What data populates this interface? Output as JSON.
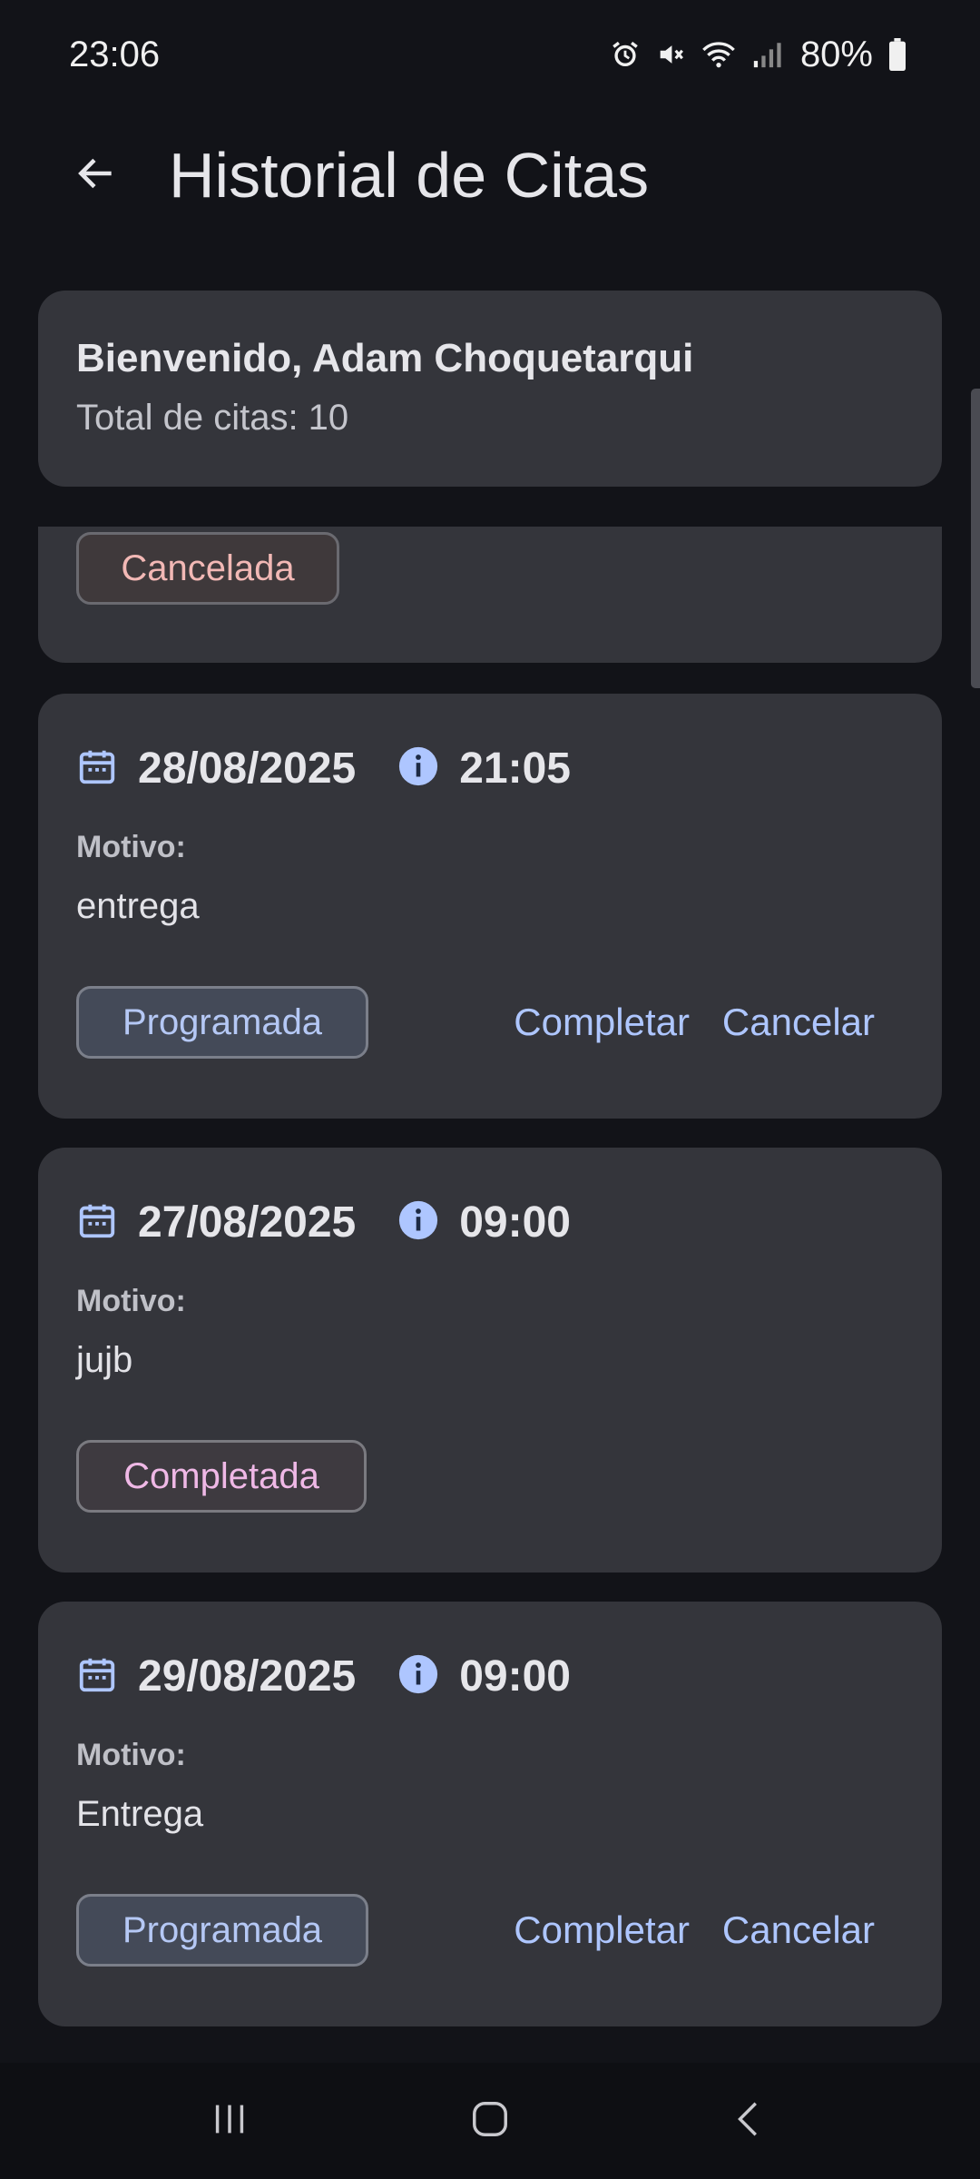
{
  "status_bar": {
    "time": "23:06",
    "battery": "80%"
  },
  "app_bar": {
    "title": "Historial de Citas"
  },
  "welcome": {
    "greeting": "Bienvenido, Adam Choquetarqui",
    "total": "Total de citas: 10"
  },
  "partial_card": {
    "status": "Cancelada"
  },
  "appointments": [
    {
      "date": "28/08/2025",
      "time": "21:05",
      "reason_label": "Motivo:",
      "reason": "entrega",
      "status": "Programada",
      "complete_label": "Completar",
      "cancel_label": "Cancelar"
    },
    {
      "date": "27/08/2025",
      "time": "09:00",
      "reason_label": "Motivo:",
      "reason": "jujb",
      "status": "Completada"
    },
    {
      "date": "29/08/2025",
      "time": "09:00",
      "reason_label": "Motivo:",
      "reason": "Entrega",
      "status": "Programada",
      "complete_label": "Completar",
      "cancel_label": "Cancelar"
    }
  ],
  "colors": {
    "background": "#121318",
    "card": "#34353b",
    "accent": "#aec6ff",
    "cancelled": "#f2b8b5",
    "completed": "#efb8e6"
  },
  "icons": [
    "alarm-icon",
    "mute-icon",
    "wifi-icon",
    "signal-icon",
    "battery-icon",
    "back-arrow-icon",
    "calendar-icon",
    "info-icon",
    "recents-icon",
    "home-icon",
    "nav-back-icon"
  ]
}
